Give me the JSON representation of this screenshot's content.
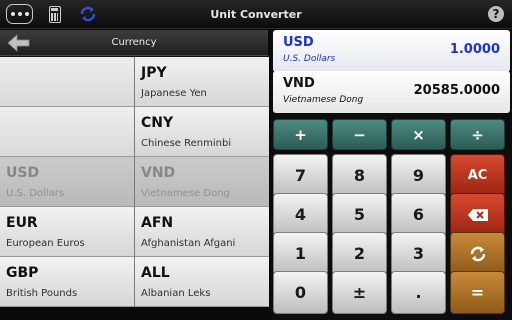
{
  "titlebar": {
    "title": "Unit Converter",
    "help_label": "?"
  },
  "category": {
    "title": "Currency"
  },
  "from_list": [
    {
      "code": "",
      "name": "",
      "selected": false
    },
    {
      "code": "",
      "name": "",
      "selected": false
    },
    {
      "code": "USD",
      "name": "U.S. Dollars",
      "selected": true
    },
    {
      "code": "EUR",
      "name": "European Euros",
      "selected": false
    },
    {
      "code": "GBP",
      "name": "British Pounds",
      "selected": false
    }
  ],
  "to_list": [
    {
      "code": "JPY",
      "name": "Japanese Yen",
      "selected": false
    },
    {
      "code": "CNY",
      "name": "Chinese Renminbi",
      "selected": false
    },
    {
      "code": "VND",
      "name": "Vietnamese Dong",
      "selected": true
    },
    {
      "code": "AFN",
      "name": "Afghanistan Afgani",
      "selected": false
    },
    {
      "code": "ALL",
      "name": "Albanian Leks",
      "selected": false
    }
  ],
  "display": {
    "from": {
      "code": "USD",
      "name": "U.S. Dollars",
      "value": "1.0000"
    },
    "to": {
      "code": "VND",
      "name": "Vietnamese Dong",
      "value": "20585.0000"
    }
  },
  "keypad": {
    "ops": [
      "+",
      "−",
      "×",
      "÷"
    ],
    "rows": [
      [
        "7",
        "8",
        "9"
      ],
      [
        "4",
        "5",
        "6"
      ],
      [
        "1",
        "2",
        "3"
      ],
      [
        "0",
        "±",
        "."
      ]
    ],
    "clear_label": "AC",
    "equals_label": "="
  },
  "colors": {
    "from_accent": "#1f32cc",
    "op_key": "#3d7a70",
    "clear_key": "#c0392b",
    "swap_key": "#b07a2e"
  }
}
